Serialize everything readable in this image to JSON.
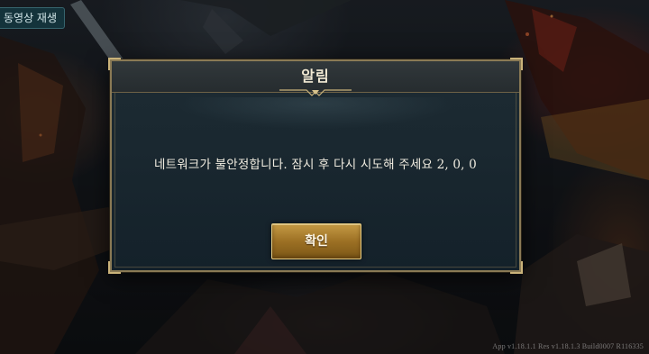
{
  "overlay": {
    "replay_label": "동영상 재생",
    "version_text": "App v1.18.1.1 Res v1.18.1.3 Build0007 R116335"
  },
  "dialog": {
    "title": "알림",
    "message": "네트워크가 불안정합니다. 잠시 후 다시 시도해 주세요",
    "error_code": "2, 0, 0",
    "confirm_label": "확인"
  },
  "colors": {
    "frame_gold": "#8a7a55",
    "button_gold": "#c59a44",
    "panel_bg": "#1a2830"
  }
}
